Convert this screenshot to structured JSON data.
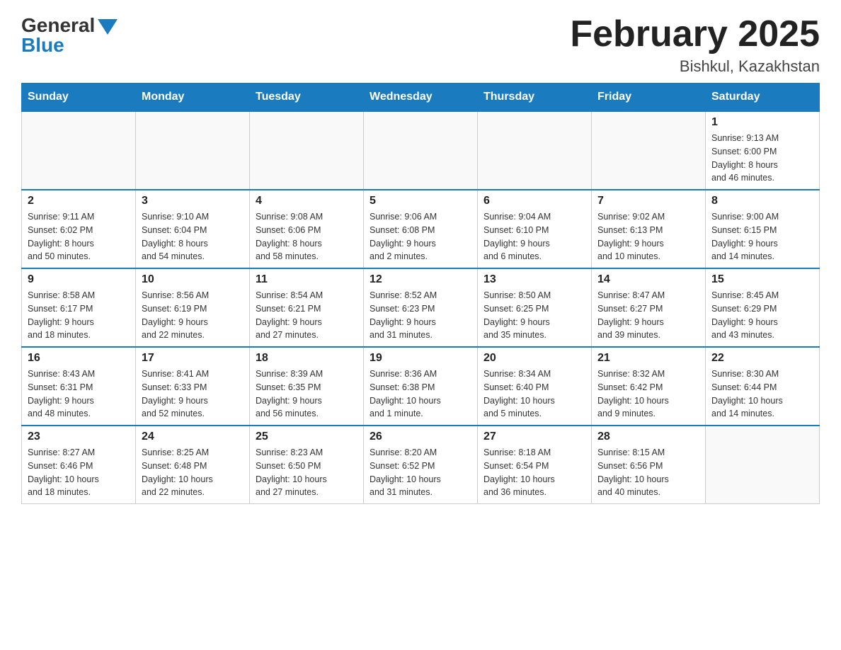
{
  "logo": {
    "general": "General",
    "blue": "Blue"
  },
  "title": "February 2025",
  "location": "Bishkul, Kazakhstan",
  "weekdays": [
    "Sunday",
    "Monday",
    "Tuesday",
    "Wednesday",
    "Thursday",
    "Friday",
    "Saturday"
  ],
  "weeks": [
    [
      {
        "day": "",
        "info": ""
      },
      {
        "day": "",
        "info": ""
      },
      {
        "day": "",
        "info": ""
      },
      {
        "day": "",
        "info": ""
      },
      {
        "day": "",
        "info": ""
      },
      {
        "day": "",
        "info": ""
      },
      {
        "day": "1",
        "info": "Sunrise: 9:13 AM\nSunset: 6:00 PM\nDaylight: 8 hours\nand 46 minutes."
      }
    ],
    [
      {
        "day": "2",
        "info": "Sunrise: 9:11 AM\nSunset: 6:02 PM\nDaylight: 8 hours\nand 50 minutes."
      },
      {
        "day": "3",
        "info": "Sunrise: 9:10 AM\nSunset: 6:04 PM\nDaylight: 8 hours\nand 54 minutes."
      },
      {
        "day": "4",
        "info": "Sunrise: 9:08 AM\nSunset: 6:06 PM\nDaylight: 8 hours\nand 58 minutes."
      },
      {
        "day": "5",
        "info": "Sunrise: 9:06 AM\nSunset: 6:08 PM\nDaylight: 9 hours\nand 2 minutes."
      },
      {
        "day": "6",
        "info": "Sunrise: 9:04 AM\nSunset: 6:10 PM\nDaylight: 9 hours\nand 6 minutes."
      },
      {
        "day": "7",
        "info": "Sunrise: 9:02 AM\nSunset: 6:13 PM\nDaylight: 9 hours\nand 10 minutes."
      },
      {
        "day": "8",
        "info": "Sunrise: 9:00 AM\nSunset: 6:15 PM\nDaylight: 9 hours\nand 14 minutes."
      }
    ],
    [
      {
        "day": "9",
        "info": "Sunrise: 8:58 AM\nSunset: 6:17 PM\nDaylight: 9 hours\nand 18 minutes."
      },
      {
        "day": "10",
        "info": "Sunrise: 8:56 AM\nSunset: 6:19 PM\nDaylight: 9 hours\nand 22 minutes."
      },
      {
        "day": "11",
        "info": "Sunrise: 8:54 AM\nSunset: 6:21 PM\nDaylight: 9 hours\nand 27 minutes."
      },
      {
        "day": "12",
        "info": "Sunrise: 8:52 AM\nSunset: 6:23 PM\nDaylight: 9 hours\nand 31 minutes."
      },
      {
        "day": "13",
        "info": "Sunrise: 8:50 AM\nSunset: 6:25 PM\nDaylight: 9 hours\nand 35 minutes."
      },
      {
        "day": "14",
        "info": "Sunrise: 8:47 AM\nSunset: 6:27 PM\nDaylight: 9 hours\nand 39 minutes."
      },
      {
        "day": "15",
        "info": "Sunrise: 8:45 AM\nSunset: 6:29 PM\nDaylight: 9 hours\nand 43 minutes."
      }
    ],
    [
      {
        "day": "16",
        "info": "Sunrise: 8:43 AM\nSunset: 6:31 PM\nDaylight: 9 hours\nand 48 minutes."
      },
      {
        "day": "17",
        "info": "Sunrise: 8:41 AM\nSunset: 6:33 PM\nDaylight: 9 hours\nand 52 minutes."
      },
      {
        "day": "18",
        "info": "Sunrise: 8:39 AM\nSunset: 6:35 PM\nDaylight: 9 hours\nand 56 minutes."
      },
      {
        "day": "19",
        "info": "Sunrise: 8:36 AM\nSunset: 6:38 PM\nDaylight: 10 hours\nand 1 minute."
      },
      {
        "day": "20",
        "info": "Sunrise: 8:34 AM\nSunset: 6:40 PM\nDaylight: 10 hours\nand 5 minutes."
      },
      {
        "day": "21",
        "info": "Sunrise: 8:32 AM\nSunset: 6:42 PM\nDaylight: 10 hours\nand 9 minutes."
      },
      {
        "day": "22",
        "info": "Sunrise: 8:30 AM\nSunset: 6:44 PM\nDaylight: 10 hours\nand 14 minutes."
      }
    ],
    [
      {
        "day": "23",
        "info": "Sunrise: 8:27 AM\nSunset: 6:46 PM\nDaylight: 10 hours\nand 18 minutes."
      },
      {
        "day": "24",
        "info": "Sunrise: 8:25 AM\nSunset: 6:48 PM\nDaylight: 10 hours\nand 22 minutes."
      },
      {
        "day": "25",
        "info": "Sunrise: 8:23 AM\nSunset: 6:50 PM\nDaylight: 10 hours\nand 27 minutes."
      },
      {
        "day": "26",
        "info": "Sunrise: 8:20 AM\nSunset: 6:52 PM\nDaylight: 10 hours\nand 31 minutes."
      },
      {
        "day": "27",
        "info": "Sunrise: 8:18 AM\nSunset: 6:54 PM\nDaylight: 10 hours\nand 36 minutes."
      },
      {
        "day": "28",
        "info": "Sunrise: 8:15 AM\nSunset: 6:56 PM\nDaylight: 10 hours\nand 40 minutes."
      },
      {
        "day": "",
        "info": ""
      }
    ]
  ]
}
